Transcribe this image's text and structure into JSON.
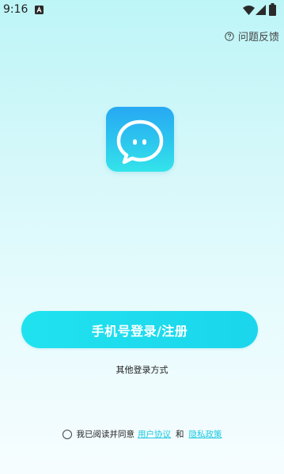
{
  "status_bar": {
    "time": "9:16"
  },
  "header": {
    "feedback_label": "问题反馈",
    "feedback_icon": "question-circle-icon"
  },
  "logo": {
    "icon": "chat-bubble-icon"
  },
  "main": {
    "primary_button_label": "手机号登录/注册",
    "other_login_label": "其他登录方式"
  },
  "agreement": {
    "prefix": "我已阅读并同意",
    "user_agreement": "用户协议",
    "and": "和",
    "privacy_policy": "隐私政策",
    "checked": false
  },
  "colors": {
    "accent": "#1fd8ec",
    "link": "#1cc9e0",
    "background_top": "#bdf5f7",
    "background_bottom": "#f6fdff"
  }
}
